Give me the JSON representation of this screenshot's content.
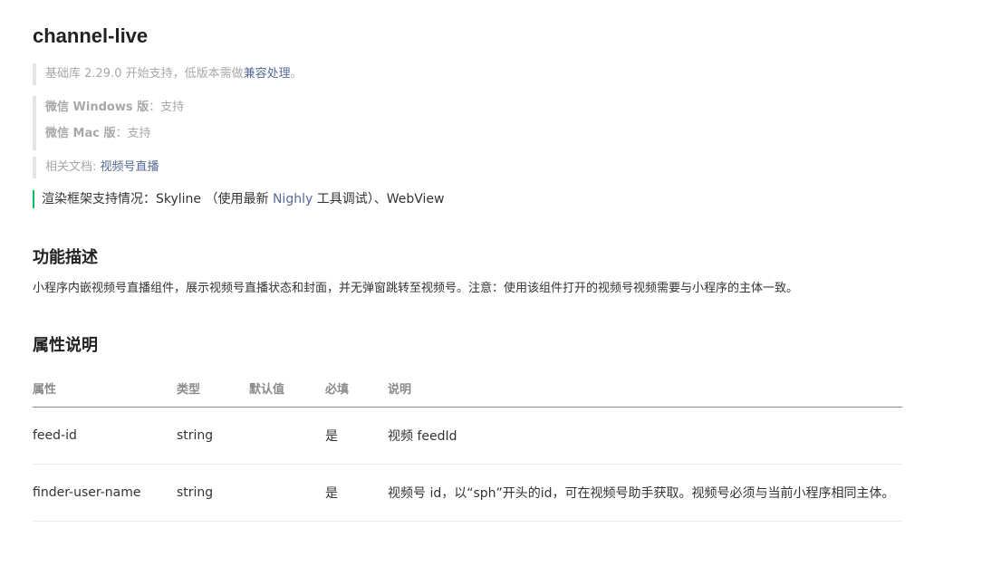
{
  "page": {
    "title": "channel-live"
  },
  "notes": {
    "version_prefix": "基础库 2.29.0 开始支持，低版本需做",
    "version_link": "兼容处理",
    "version_suffix": "。",
    "windows_label": "微信 Windows 版",
    "windows_value": "：支持",
    "mac_label": "微信 Mac 版",
    "mac_value": "：支持",
    "docs_label": "相关文档: ",
    "docs_link": "视频号直播"
  },
  "render": {
    "prefix": "渲染框架支持情况：Skyline （使用最新 ",
    "link": "Nighly",
    "suffix": " 工具调试）、WebView"
  },
  "sections": {
    "description_title": "功能描述",
    "description_text": "小程序内嵌视频号直播组件，展示视频号直播状态和封面，并无弹窗跳转至视频号。注意：使用该组件打开的视频号视频需要与小程序的主体一致。",
    "attributes_title": "属性说明"
  },
  "table": {
    "headers": [
      "属性",
      "类型",
      "默认值",
      "必填",
      "说明"
    ],
    "rows": [
      [
        "feed-id",
        "string",
        "",
        "是",
        "视频 feedId"
      ],
      [
        "finder-user-name",
        "string",
        "",
        "是",
        "视频号 id，以“sph”开头的id，可在视频号助手获取。视频号必须与当前小程序相同主体。"
      ]
    ]
  },
  "colors": {
    "link": "#576b95",
    "accent_bar": "#07c160",
    "quote_bar": "#e5e5e5",
    "muted_text": "#a8a8a8"
  }
}
